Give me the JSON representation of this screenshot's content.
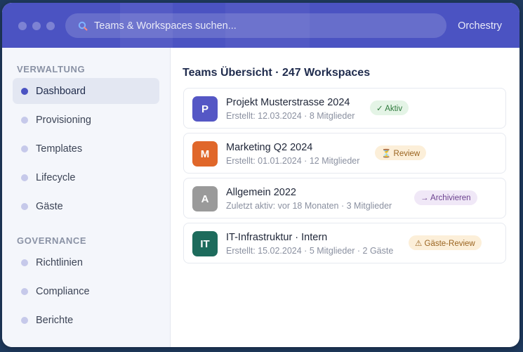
{
  "topbar": {
    "search_placeholder": "Teams & Workspaces suchen...",
    "brand": "Orchestry"
  },
  "sidebar": {
    "sections": [
      {
        "title": "VERWALTUNG",
        "items": [
          "Dashboard",
          "Provisioning",
          "Templates",
          "Lifecycle",
          "Gäste"
        ]
      },
      {
        "title": "GOVERNANCE",
        "items": [
          "Richtlinien",
          "Compliance",
          "Berichte"
        ]
      }
    ],
    "active_item": "Dashboard"
  },
  "main": {
    "title": "Teams Übersicht · 247 Workspaces",
    "cards": [
      {
        "initial": "P",
        "avatar_color": "#5557c5",
        "title": "Projekt Musterstrasse 2024",
        "subtitle": "Erstellt: 12.03.2024 · 8 Mitglieder",
        "badge": "✓ Aktiv",
        "badge_bg": "#e4f4e6",
        "badge_fg": "#2f7a3c"
      },
      {
        "initial": "M",
        "avatar_color": "#e0672a",
        "title": "Marketing Q2 2024",
        "subtitle": "Erstellt: 01.01.2024 · 12 Mitglieder",
        "badge": "⏳ Review",
        "badge_bg": "#fcefd9",
        "badge_fg": "#9a6420"
      },
      {
        "initial": "A",
        "avatar_color": "#9a9a9a",
        "title": "Allgemein 2022",
        "subtitle": "Zuletzt aktiv: vor 18 Monaten · 3 Mitglieder",
        "badge": "→ Archivieren",
        "badge_bg": "#f0e8f7",
        "badge_fg": "#6a3f8e"
      },
      {
        "initial": "IT",
        "avatar_color": "#1d6b5c",
        "title": "IT-Infrastruktur · Intern",
        "subtitle": "Erstellt: 15.02.2024 · 5 Mitglieder · 2 Gäste",
        "badge": "⚠ Gäste-Review",
        "badge_bg": "#fcefd9",
        "badge_fg": "#9a6420"
      }
    ]
  }
}
